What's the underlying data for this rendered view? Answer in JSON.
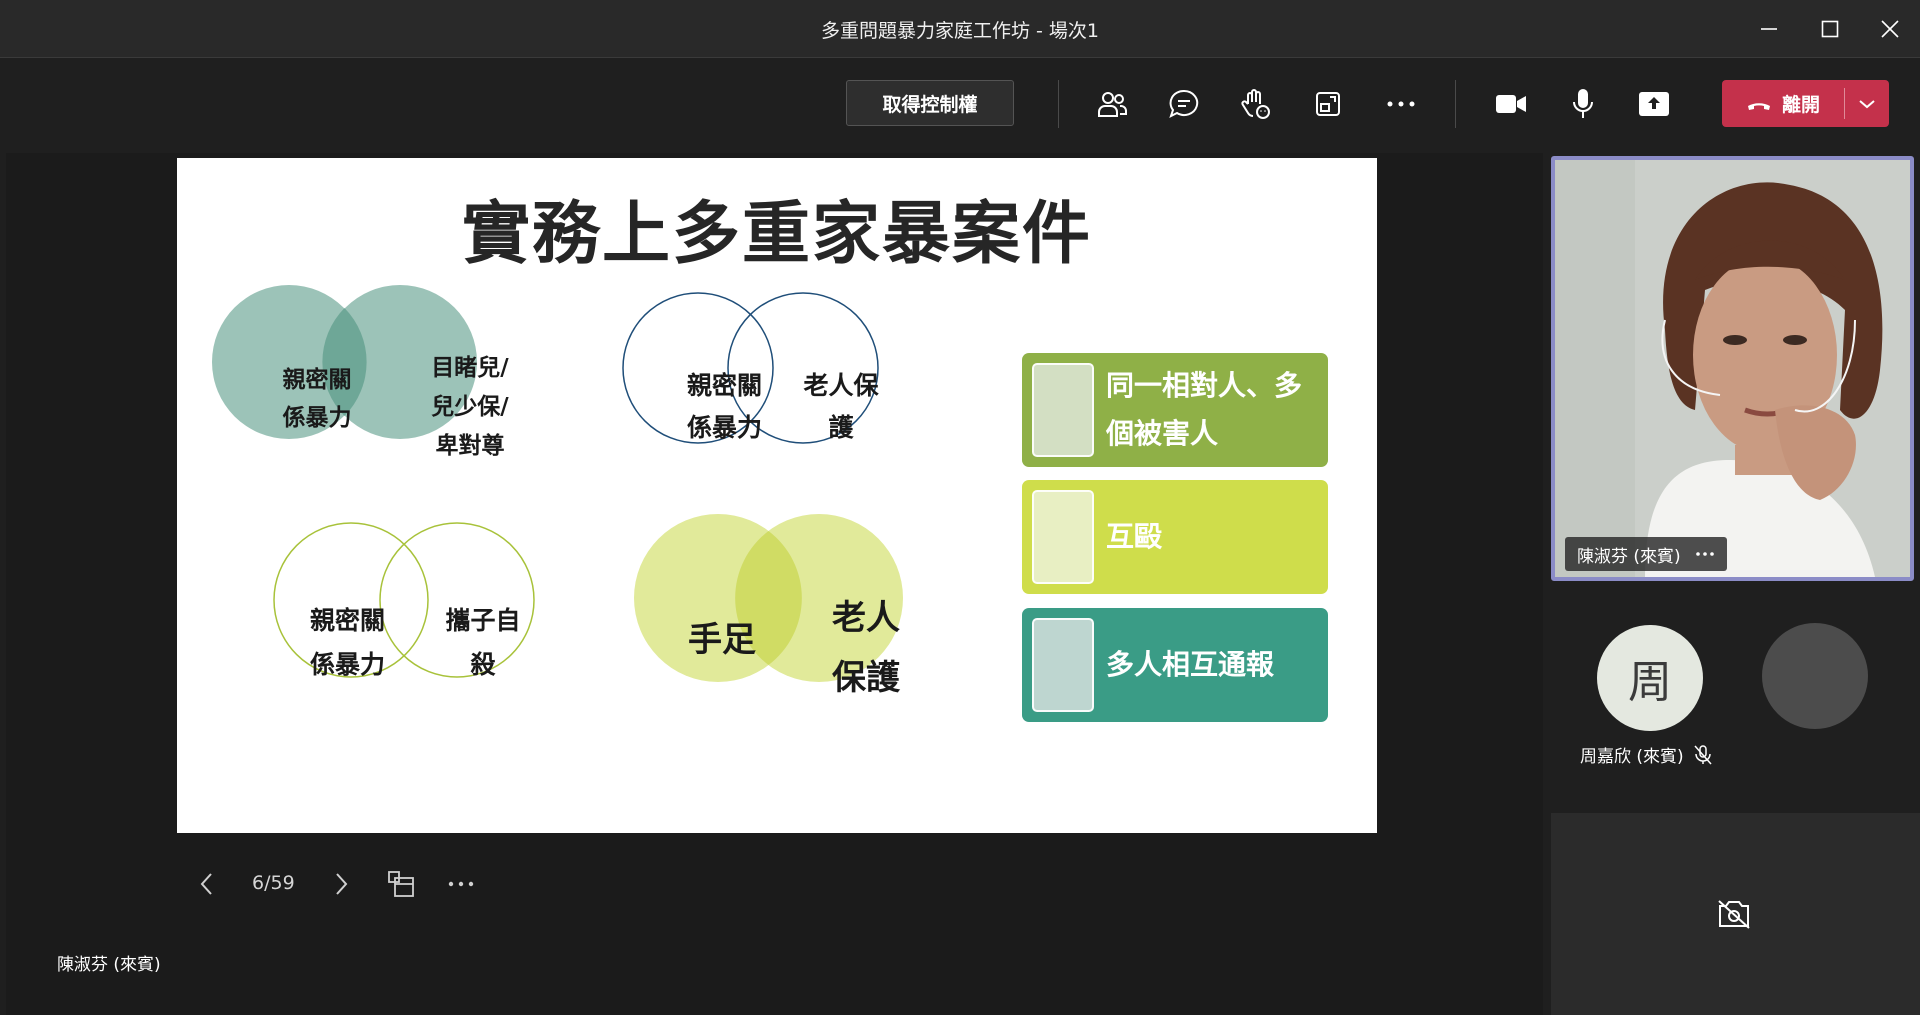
{
  "window": {
    "title": "多重問題暴力家庭工作坊 - 場次1"
  },
  "toolbar": {
    "take_control_label": "取得控制權",
    "leave_label": "離開",
    "icons": [
      "people-icon",
      "chat-icon",
      "raise-hand-icon",
      "share-tray-icon",
      "more-icon",
      "camera-icon",
      "microphone-icon",
      "share-screen-icon"
    ]
  },
  "slide": {
    "title": "實務上多重家暴案件",
    "venn": [
      {
        "left": "親密關係暴力",
        "right": "目睹兒/兒少保/卑對尊"
      },
      {
        "left": "親密關係暴力",
        "right": "老人保護"
      },
      {
        "left": "親密關係暴力",
        "right": "攜子自殺"
      },
      {
        "left": "手足",
        "right": "老人保護"
      }
    ],
    "venn_lines": {
      "v1_left": [
        "親密關",
        "係暴力"
      ],
      "v1_right": [
        "目睹兒/",
        "兒少保/",
        "卑對尊"
      ],
      "v2_left": [
        "親密關",
        "係暴力"
      ],
      "v2_right": [
        "老人保",
        "護"
      ],
      "v3_left": [
        "親密關",
        "係暴力"
      ],
      "v3_right": [
        "攜子自",
        "殺"
      ],
      "v4_left": [
        "手足"
      ],
      "v4_right": [
        "老人",
        "保護"
      ]
    },
    "boxes": [
      {
        "line1": "同一相對人、多",
        "line2": "個被害人",
        "color": "#8fb047"
      },
      {
        "line1": "互毆",
        "line2": "",
        "color": "#cfdd4b"
      },
      {
        "line1": "多人相互通報",
        "line2": "",
        "color": "#3a9c86"
      }
    ]
  },
  "slide_nav": {
    "page": "6/59"
  },
  "presenter_name": "陳淑芬 (來賓)",
  "participants": {
    "main_video_name": "陳淑芬 (來賓)",
    "zhou_initial": "周",
    "zhou_name": "周嘉欣 (來賓)"
  },
  "colors": {
    "leave_red": "#c4314b",
    "tile_border": "#8b8cc7"
  }
}
